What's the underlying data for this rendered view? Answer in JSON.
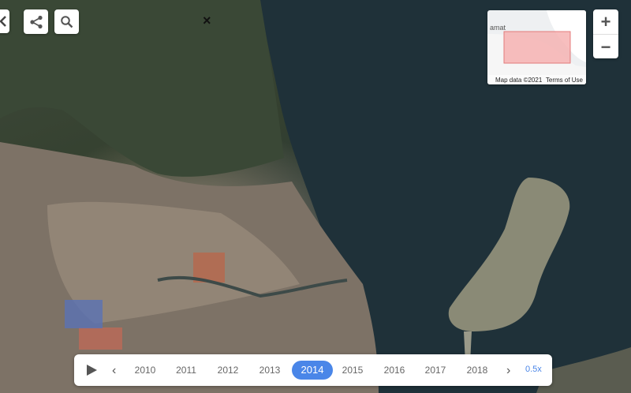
{
  "controls": {
    "share_icon": "share-icon",
    "search_icon": "search-icon",
    "zoom_in_label": "+",
    "zoom_out_label": "−"
  },
  "minimap": {
    "place_label": "amat",
    "attribution": "Map data ©2021",
    "terms": "Terms of Use"
  },
  "map_marker": "×",
  "timeline": {
    "years": [
      "2010",
      "2011",
      "2012",
      "2013",
      "2014",
      "2015",
      "2016",
      "2017",
      "2018"
    ],
    "selected_year": "2014",
    "speed": "0.5x"
  }
}
